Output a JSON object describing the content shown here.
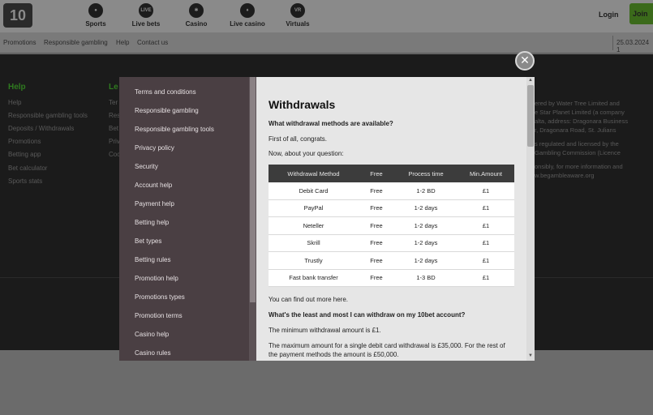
{
  "header": {
    "logo": "10",
    "nav": [
      {
        "label": "Sports",
        "icon": "sports-ball-icon"
      },
      {
        "label": "Live bets",
        "icon": "live-icon",
        "badge": "LIVE"
      },
      {
        "label": "Casino",
        "icon": "casino-chip-icon"
      },
      {
        "label": "Live casino",
        "icon": "live-casino-icon"
      },
      {
        "label": "Virtuals",
        "icon": "virtuals-icon",
        "badge": "VR"
      }
    ],
    "login": "Login",
    "join": "Join"
  },
  "subnav": {
    "items": [
      "Promotions",
      "Responsible gambling",
      "Help",
      "Contact us"
    ],
    "date": "25.03.2024 1"
  },
  "footer": {
    "help_heading": "Help",
    "help_links": [
      "Help",
      "Responsible gambling tools",
      "Deposits / Withdrawals",
      "Promotions",
      "Betting app",
      "Bet calculator",
      "Sports stats"
    ],
    "second_heading": "Le",
    "second_links": [
      "Ter",
      "Res",
      "Bet",
      "Priv",
      "Coc"
    ],
    "right_lines": [
      "ered by Water Tree Limited and",
      "e Star Planet Limited (a company",
      "alta, address: Dragonara Business",
      "r, Dragonara Road, St. Julians",
      "",
      "s regulated and licensed by the",
      "Gambling Commission (Licence",
      "",
      "onsibly, for more information and",
      "w.begambleaware.org"
    ]
  },
  "modal": {
    "close": "✕",
    "menu": [
      "Terms and conditions",
      "Responsible gambling",
      "Responsible gambling tools",
      "Privacy policy",
      "Security",
      "Account help",
      "Payment help",
      "Betting help",
      "Bet types",
      "Betting rules",
      "Promotion help",
      "Promotions types",
      "Promotion terms",
      "Casino help",
      "Casino rules"
    ],
    "content": {
      "title": "Withdrawals",
      "q1": "What withdrawal methods are available?",
      "p1": "First of all, congrats.",
      "p2": "Now, about your question:",
      "table": {
        "headers": [
          "Withdrawal Method",
          "Free",
          "Process time",
          "Min.Amount"
        ],
        "rows": [
          [
            "Debit Card",
            "Free",
            "1-2 BD",
            "£1"
          ],
          [
            "PayPal",
            "Free",
            "1-2 days",
            "£1"
          ],
          [
            "Neteller",
            "Free",
            "1-2 days",
            "£1"
          ],
          [
            "Skrill",
            "Free",
            "1-2 days",
            "£1"
          ],
          [
            "Trustly",
            "Free",
            "1-2 days",
            "£1"
          ],
          [
            "Fast bank transfer",
            "Free",
            "1-3 BD",
            "£1"
          ]
        ]
      },
      "more": "You can find out more here.",
      "q2": "What's the least and most I can withdraw on my 10bet account?",
      "p3": "The minimum withdrawal amount is £1.",
      "p4": "The maximum amount for a single debit card withdrawal is £35,000. For the rest of the payment methods the amount is £50,000."
    }
  }
}
